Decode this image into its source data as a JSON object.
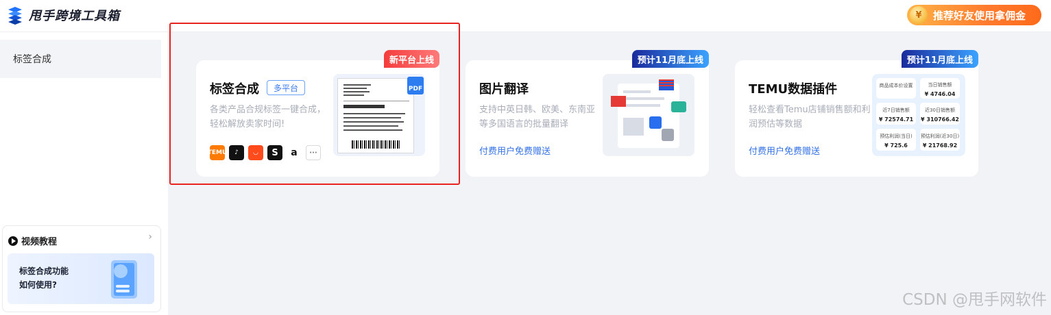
{
  "header": {
    "logo_text": "甩手跨境工具箱",
    "referral_label": "推荐好友使用拿佣金",
    "referral_coin": "¥"
  },
  "sidebar": {
    "items": [
      {
        "label": "标签合成"
      }
    ],
    "tutorial": {
      "title": "视频教程",
      "chevron": "›",
      "card_line1": "标签合成功能",
      "card_line2": "如何使用?"
    }
  },
  "cards": [
    {
      "title": "标签合成",
      "tag": "多平台",
      "desc": "各类产品合规标签一键合成，轻松解放卖家时间!",
      "badge": "新平台上线",
      "platforms": [
        "temu-icon",
        "tiktok-icon",
        "aliexpress-icon",
        "shein-icon",
        "amazon-icon",
        "more-icon"
      ],
      "pdf_label": "PDF"
    },
    {
      "title": "图片翻译",
      "desc": "支持中英日韩、欧美、东南亚等多国语言的批量翻译",
      "badge": "预计11月底上线",
      "link": "付费用户免费赠送"
    },
    {
      "title": "TEMU数据插件",
      "desc": "轻松查看Temu店铺销售额和利润预估等数据",
      "badge": "预计11月底上线",
      "link": "付费用户免费赠送",
      "stats": [
        {
          "label": "商品成本价设置",
          "value": ""
        },
        {
          "label": "当日销售额",
          "value": "¥ 4746.04"
        },
        {
          "label": "近7日销售额",
          "value": "¥ 72574.71"
        },
        {
          "label": "近30日销售额",
          "value": "¥ 310766.42"
        },
        {
          "label": "预估利润(当日)",
          "value": "¥ 725.6"
        },
        {
          "label": "预估利润(近30日)",
          "value": "¥ 21768.92"
        }
      ]
    }
  ],
  "watermark": "CSDN @甩手网软件",
  "colors": {
    "accent": "#3472e6",
    "highlight": "#e8221e",
    "badge_red": "#f43c3c",
    "badge_blue": "#1a2a9c"
  }
}
